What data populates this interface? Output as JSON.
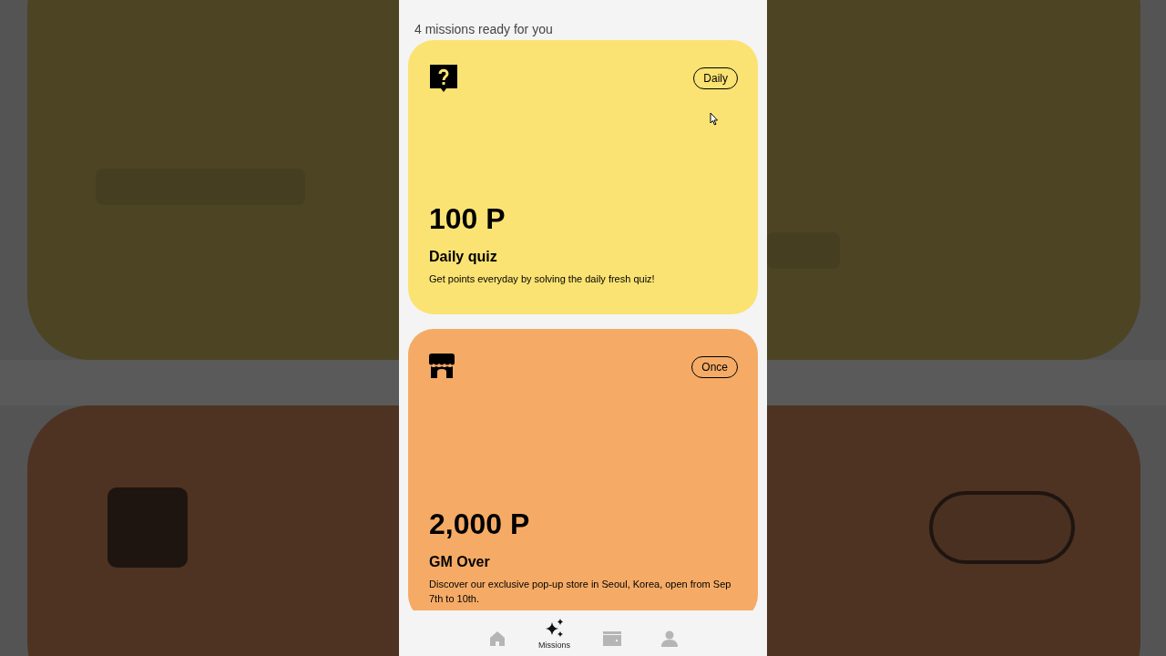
{
  "header": {
    "subtitle": "4 missions ready for you"
  },
  "missions": [
    {
      "kind": "quiz",
      "color": "#fae373",
      "frequency": "Daily",
      "points": "100 P",
      "title": "Daily quiz",
      "description": "Get points everyday by solving the daily fresh quiz!"
    },
    {
      "kind": "store",
      "color": "#f5ab66",
      "frequency": "Once",
      "points": "2,000 P",
      "title": "GM Over",
      "description": "Discover our exclusive pop-up store in Seoul, Korea, open from Sep 7th to 10th."
    }
  ],
  "nav": [
    {
      "kind": "home",
      "selected": false
    },
    {
      "kind": "missions",
      "selected": true,
      "label": "Missions"
    },
    {
      "kind": "wallet",
      "selected": false
    },
    {
      "kind": "profile",
      "selected": false
    }
  ]
}
